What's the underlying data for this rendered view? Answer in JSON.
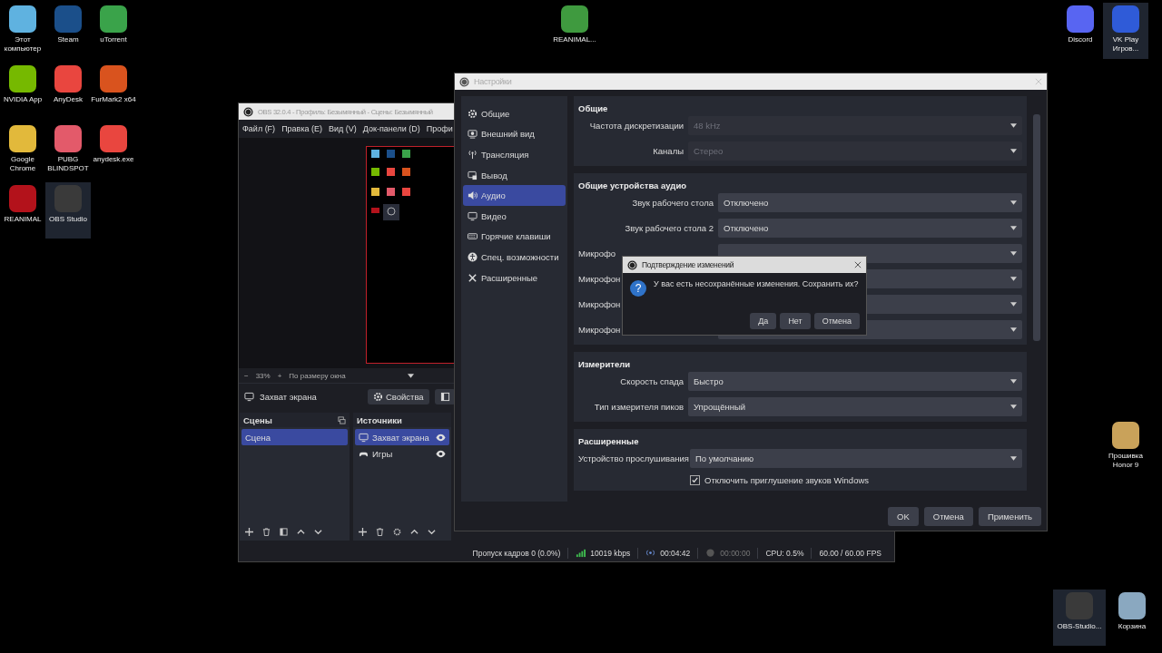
{
  "desktop": {
    "left_icons": [
      {
        "label": "Этот компьютер",
        "selected": false
      },
      {
        "label": "Steam",
        "selected": false
      },
      {
        "label": "uTorrent",
        "selected": false
      },
      {
        "label": "NVIDIA App",
        "selected": false
      },
      {
        "label": "AnyDesk",
        "selected": false
      },
      {
        "label": "FurMark2 x64",
        "selected": false
      },
      {
        "label": "Google Chrome",
        "selected": false
      },
      {
        "label": "PUBG BLINDSPOT",
        "selected": false
      },
      {
        "label": "anydesk.exe",
        "selected": false
      },
      {
        "label": "REANIMAL",
        "selected": false
      },
      {
        "label": "OBS Studio",
        "selected": true
      }
    ],
    "top_icons": [
      {
        "label": "REANIMAL...",
        "selected": false
      }
    ],
    "top_right_icons": [
      {
        "label": "Discord",
        "selected": false
      },
      {
        "label": "VK Play Игров...",
        "selected": true
      }
    ],
    "right_icons": [
      {
        "label": "Прошивка Honor 9",
        "selected": false
      }
    ],
    "bottom_right_icons": [
      {
        "label": "OBS-Studio...",
        "selected": true
      },
      {
        "label": "Корзина",
        "selected": false
      }
    ]
  },
  "obs_window": {
    "title": "OBS 32.0.4 - Профиль: Безымянный - Сцены: Безымянный",
    "menu": [
      "Файл (F)",
      "Правка (E)",
      "Вид (V)",
      "Док-панели (D)",
      "Профи"
    ],
    "zoom": {
      "minus": "−",
      "value": "33%",
      "plus": "+",
      "fit": "По размеру окна"
    },
    "source_bar": {
      "source": "Захват экрана",
      "properties": "Свойства"
    },
    "scenes": {
      "title": "Сцены",
      "items": [
        {
          "label": "Сцена",
          "selected": true
        }
      ]
    },
    "sources": {
      "title": "Источники",
      "items": [
        {
          "label": "Захват экрана",
          "selected": true,
          "kind": "display",
          "visible": true
        },
        {
          "label": "Игры",
          "selected": false,
          "kind": "game",
          "visible": true
        }
      ]
    },
    "status": {
      "dropped": "Пропуск кадров 0 (0.0%)",
      "bitrate": "10019 kbps",
      "stream_time": "00:04:42",
      "record_time": "00:00:00",
      "cpu": "CPU: 0.5%",
      "fps": "60.00 / 60.00 FPS"
    }
  },
  "settings": {
    "title": "Настройки",
    "nav": [
      {
        "label": "Общие",
        "selected": false,
        "kind": "gear"
      },
      {
        "label": "Внешний вид",
        "selected": false,
        "kind": "appearance"
      },
      {
        "label": "Трансляция",
        "selected": false,
        "kind": "stream"
      },
      {
        "label": "Вывод",
        "selected": false,
        "kind": "output"
      },
      {
        "label": "Аудио",
        "selected": true,
        "kind": "audio"
      },
      {
        "label": "Видео",
        "selected": false,
        "kind": "video"
      },
      {
        "label": "Горячие клавиши",
        "selected": false,
        "kind": "keyboard"
      },
      {
        "label": "Спец. возможности",
        "selected": false,
        "kind": "accessibility"
      },
      {
        "label": "Расширенные",
        "selected": false,
        "kind": "tools"
      }
    ],
    "sections": [
      {
        "title": "Общие",
        "rows": [
          {
            "label": "Частота дискретизации",
            "value": "48 kHz",
            "disabled": true
          },
          {
            "label": "Каналы",
            "value": "Стерео",
            "disabled": true
          }
        ]
      },
      {
        "title": "Общие устройства аудио",
        "rows": [
          {
            "label": "Звук рабочего стола",
            "value": "Отключено",
            "disabled": false
          },
          {
            "label": "Звук рабочего стола 2",
            "value": "Отключено",
            "disabled": false
          },
          {
            "label": "Микрофо",
            "disabled": false
          },
          {
            "label": "Микрофон",
            "disabled": false
          },
          {
            "label": "Микрофон",
            "disabled": false
          },
          {
            "label": "Микрофон",
            "disabled": false
          }
        ]
      },
      {
        "title": "Измерители",
        "rows": [
          {
            "label": "Скорость спада",
            "value": "Быстро",
            "disabled": false
          },
          {
            "label": "Тип измерителя пиков",
            "value": "Упрощённый",
            "disabled": false
          }
        ]
      },
      {
        "title": "Расширенные",
        "rows": [
          {
            "label": "Устройство прослушивания",
            "value": "По умолчанию",
            "disabled": false
          }
        ],
        "checkbox": {
          "label": "Отключить приглушение звуков Windows",
          "checked": true
        }
      }
    ],
    "buttons": [
      "OK",
      "Отмена",
      "Применить"
    ]
  },
  "dialog": {
    "title": "Подтверждение изменений",
    "icon": "?",
    "message": "У вас есть несохранённые изменения. Сохранить их?",
    "buttons": [
      "Да",
      "Нет",
      "Отмена"
    ]
  }
}
